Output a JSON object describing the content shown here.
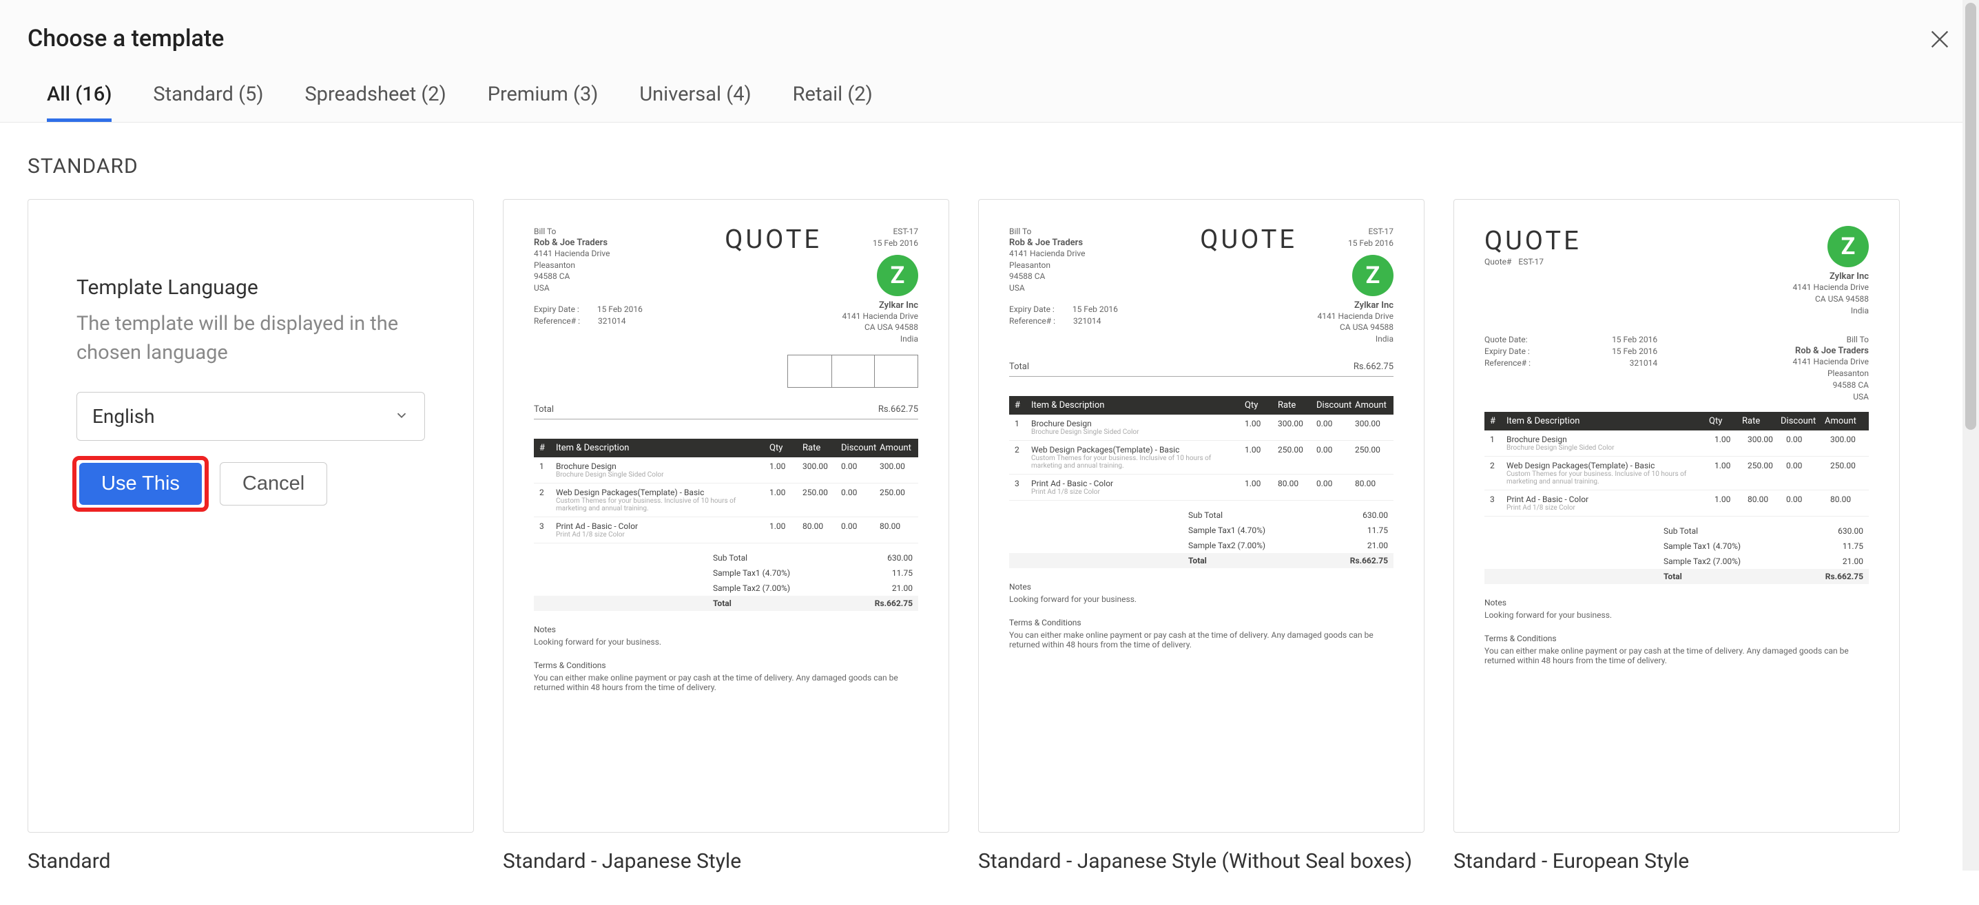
{
  "header": {
    "title": "Choose a template"
  },
  "tabs": {
    "all": {
      "label": "All (16)",
      "active": true
    },
    "standard": {
      "label": "Standard (5)"
    },
    "spreadsheet": {
      "label": "Spreadsheet (2)"
    },
    "premium": {
      "label": "Premium (3)"
    },
    "universal": {
      "label": "Universal (4)"
    },
    "retail": {
      "label": "Retail (2)"
    }
  },
  "section": {
    "title": "STANDARD"
  },
  "lang_card": {
    "heading": "Template Language",
    "description": "The template will be displayed in the chosen language",
    "selected_language": "English",
    "use_button": "Use This",
    "cancel_button": "Cancel",
    "card_label": "Standard"
  },
  "cards": {
    "jp": {
      "label": "Standard - Japanese Style"
    },
    "jp_no_seal": {
      "label": "Standard - Japanese Style (Without Seal boxes)"
    },
    "euro": {
      "label": "Standard - European Style"
    }
  },
  "preview": {
    "doc_type": "QUOTE",
    "doc_no_label": "Quote#",
    "doc_no": "EST-17",
    "doc_date": "15 Feb 2016",
    "bill_to_label": "Bill To",
    "bill_to": {
      "name": "Rob & Joe Traders",
      "line1": "4141 Hacienda Drive",
      "city": "Pleasanton",
      "region": "94588 CA",
      "country": "USA"
    },
    "expiry_label": "Expiry Date :",
    "quote_date_label": "Quote Date:",
    "reference_label": "Reference# :",
    "reference": "321014",
    "company": {
      "name": "Zylkar Inc",
      "line1": "4141 Hacienda Drive",
      "region": "CA USA 94588",
      "country": "India"
    },
    "summary_line": {
      "label": "Total",
      "value": "Rs.662.75"
    },
    "columns": [
      "#",
      "Item & Description",
      "Qty",
      "Rate",
      "Discount",
      "Amount"
    ],
    "items": [
      {
        "idx": "1",
        "name": "Brochure Design",
        "desc": "Brochure Design Single Sided Color",
        "qty": "1.00",
        "rate": "300.00",
        "discount": "0.00",
        "amount": "300.00"
      },
      {
        "idx": "2",
        "name": "Web Design Packages(Template) - Basic",
        "desc": "Custom Themes for your business. Inclusive of 10 hours of marketing and annual training.",
        "qty": "1.00",
        "rate": "250.00",
        "discount": "0.00",
        "amount": "250.00"
      },
      {
        "idx": "3",
        "name": "Print Ad - Basic - Color",
        "desc": "Print Ad 1/8 size Color",
        "qty": "1.00",
        "rate": "80.00",
        "discount": "0.00",
        "amount": "80.00"
      }
    ],
    "totals": {
      "subtotal_label": "Sub Total",
      "subtotal": "630.00",
      "tax1_label": "Sample Tax1 (4.70%)",
      "tax1": "11.75",
      "tax2_label": "Sample Tax2 (7.00%)",
      "tax2": "21.00",
      "total_label": "Total",
      "total": "Rs.662.75"
    },
    "notes": {
      "heading": "Notes",
      "body": "Looking forward for your business."
    },
    "terms": {
      "heading": "Terms & Conditions",
      "body": "You can either make online payment or pay cash at the time of delivery. Any damaged goods can be returned within 48 hours from the time of delivery."
    }
  }
}
